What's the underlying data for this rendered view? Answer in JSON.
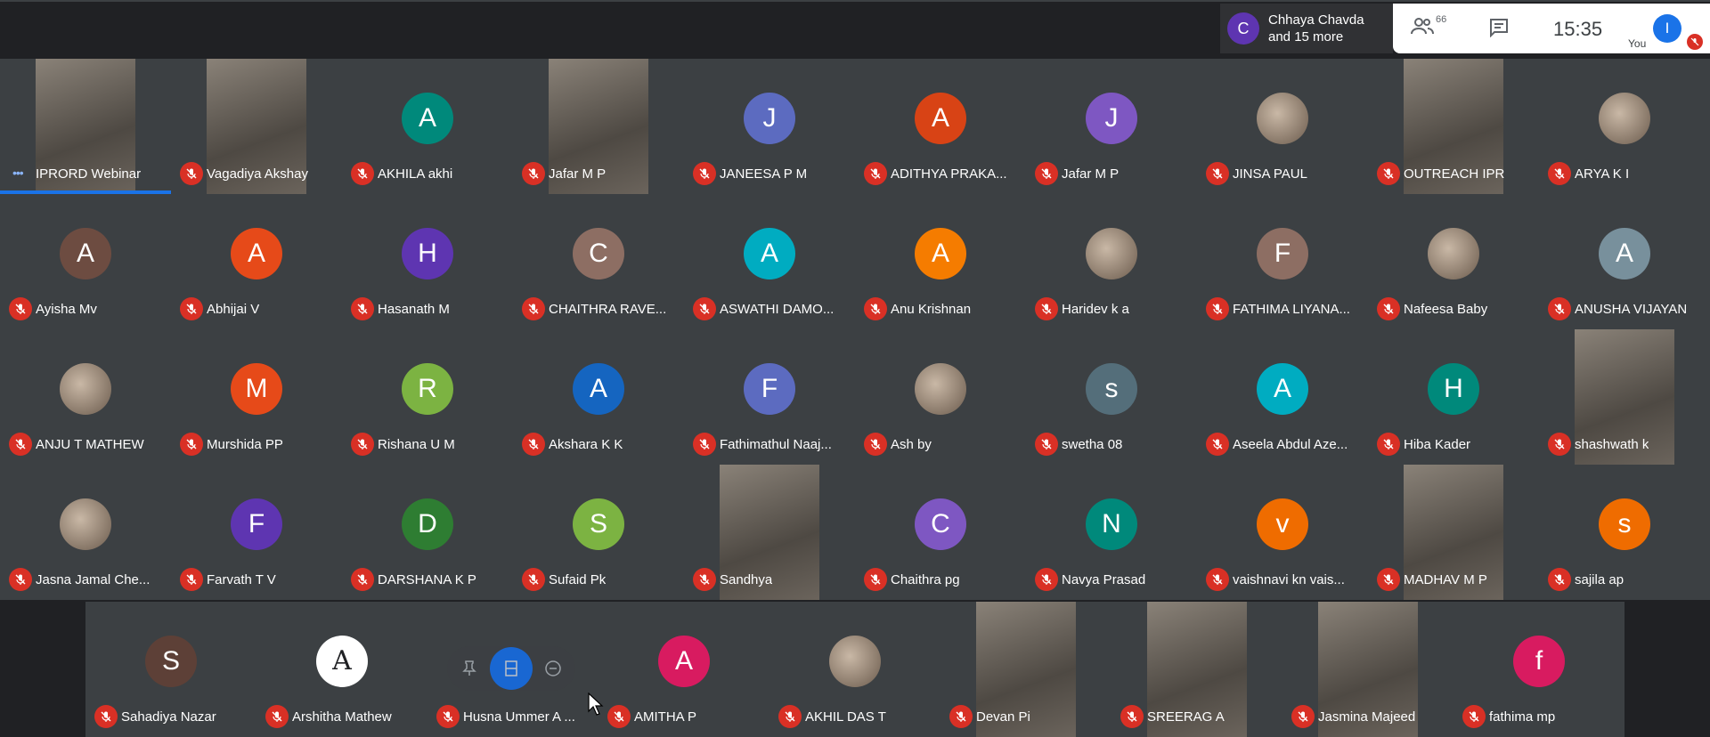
{
  "topbar": {
    "presenter": {
      "avatar_letter": "C",
      "text_line1": "Chhaya Chavda",
      "text_line2": "and 15 more"
    },
    "controls": {
      "people_count": "66",
      "time": "15:35",
      "you_label": "You",
      "you_avatar_letter": "I"
    }
  },
  "participants": [
    {
      "name": "IPRORD Webinar",
      "kind": "video",
      "muted": false,
      "speaking": true
    },
    {
      "name": "Vagadiya Akshay",
      "kind": "video",
      "muted": true
    },
    {
      "name": "AKHILA akhi",
      "letter": "A",
      "color": "#00897b",
      "muted": true
    },
    {
      "name": "Jafar M P",
      "kind": "video",
      "muted": true
    },
    {
      "name": "JANEESA P M",
      "letter": "J",
      "color": "#5c6bc0",
      "muted": true
    },
    {
      "name": "ADITHYA PRAKA...",
      "letter": "A",
      "color": "#d84315",
      "muted": true
    },
    {
      "name": "Jafar M P",
      "letter": "J",
      "color": "#7e57c2",
      "muted": true
    },
    {
      "name": "JINSA PAUL",
      "kind": "photo",
      "muted": true
    },
    {
      "name": "OUTREACH IPR",
      "kind": "video",
      "muted": true
    },
    {
      "name": "ARYA K I",
      "kind": "photo",
      "muted": true
    },
    {
      "name": "Ayisha Mv",
      "letter": "A",
      "color": "#6d4c41",
      "muted": true
    },
    {
      "name": "Abhijai V",
      "letter": "A",
      "color": "#e64a19",
      "muted": true
    },
    {
      "name": "Hasanath M",
      "letter": "H",
      "color": "#5e35b1",
      "muted": true
    },
    {
      "name": "CHAITHRA RAVE...",
      "letter": "C",
      "color": "#8d6e63",
      "muted": true
    },
    {
      "name": "ASWATHI DAMO...",
      "letter": "A",
      "color": "#00acc1",
      "muted": true
    },
    {
      "name": "Anu Krishnan",
      "letter": "A",
      "color": "#f57c00",
      "muted": true
    },
    {
      "name": "Haridev k a",
      "kind": "photo",
      "muted": true
    },
    {
      "name": "FATHIMA LIYANA...",
      "letter": "F",
      "color": "#8d6e63",
      "muted": true
    },
    {
      "name": "Nafeesa Baby",
      "kind": "photo",
      "muted": true
    },
    {
      "name": "ANUSHA VIJAYAN",
      "letter": "A",
      "color": "#78909c",
      "muted": true
    },
    {
      "name": "ANJU T MATHEW",
      "kind": "photo",
      "muted": true
    },
    {
      "name": "Murshida PP",
      "letter": "M",
      "color": "#e64a19",
      "muted": true
    },
    {
      "name": "Rishana U M",
      "letter": "R",
      "color": "#7cb342",
      "muted": true
    },
    {
      "name": "Akshara K K",
      "letter": "A",
      "color": "#1565c0",
      "muted": true
    },
    {
      "name": "Fathimathul Naaj...",
      "letter": "F",
      "color": "#5c6bc0",
      "muted": true
    },
    {
      "name": "Ash by",
      "kind": "photo",
      "muted": true
    },
    {
      "name": "swetha 08",
      "letter": "s",
      "color": "#546e7a",
      "muted": true
    },
    {
      "name": "Aseela Abdul Aze...",
      "letter": "A",
      "color": "#00acc1",
      "muted": true
    },
    {
      "name": "Hiba Kader",
      "letter": "H",
      "color": "#00897b",
      "muted": true
    },
    {
      "name": "shashwath k",
      "kind": "video",
      "muted": true
    },
    {
      "name": "Jasna Jamal Che...",
      "kind": "photo",
      "muted": true
    },
    {
      "name": "Farvath T V",
      "letter": "F",
      "color": "#5e35b1",
      "muted": true
    },
    {
      "name": "DARSHANA K P",
      "letter": "D",
      "color": "#2e7d32",
      "muted": true
    },
    {
      "name": "Sufaid Pk",
      "letter": "S",
      "color": "#7cb342",
      "muted": true
    },
    {
      "name": "Sandhya",
      "kind": "video",
      "muted": true
    },
    {
      "name": "Chaithra pg",
      "letter": "C",
      "color": "#7e57c2",
      "muted": true
    },
    {
      "name": "Navya Prasad",
      "letter": "N",
      "color": "#00897b",
      "muted": true
    },
    {
      "name": "vaishnavi kn vais...",
      "letter": "v",
      "color": "#ef6c00",
      "muted": true
    },
    {
      "name": "MADHAV M P",
      "kind": "video",
      "muted": true
    },
    {
      "name": "sajila ap",
      "letter": "s",
      "color": "#ef6c00",
      "muted": true
    }
  ],
  "bottom_row": [
    {
      "name": "Sahadiya Nazar",
      "letter": "S",
      "color": "#5d4037",
      "muted": true
    },
    {
      "name": "Arshitha Mathew",
      "letter": "A",
      "color": "#ffffff",
      "text_color": "#202124",
      "muted": true
    },
    {
      "name": "Husna Ummer A ...",
      "kind": "blank",
      "muted": true
    },
    {
      "name": "AMITHA P",
      "letter": "A",
      "color": "#d81b60",
      "muted": true
    },
    {
      "name": "AKHIL DAS T",
      "kind": "photo",
      "muted": true
    },
    {
      "name": "Devan Pi",
      "kind": "video",
      "muted": true
    },
    {
      "name": "SREERAG A",
      "kind": "video",
      "muted": true
    },
    {
      "name": "Jasmina Majeed",
      "kind": "video",
      "muted": true
    },
    {
      "name": "fathima mp",
      "letter": "f",
      "color": "#d81b60",
      "muted": true
    }
  ],
  "icons": {
    "mic_off": "mic-off-icon",
    "pin": "pin-icon",
    "remove": "remove-icon",
    "layout": "layout-icon"
  }
}
